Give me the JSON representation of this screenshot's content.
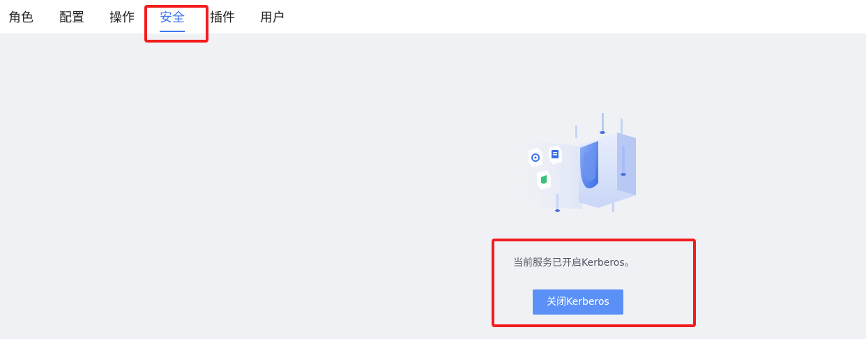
{
  "tabs": {
    "roles": "角色",
    "config": "配置",
    "operations": "操作",
    "security": "安全",
    "plugins": "插件",
    "users": "用户"
  },
  "active_tab": "security",
  "security": {
    "status_text": "当前服务已开启Kerberos。",
    "disable_button": "关闭Kerberos"
  },
  "colors": {
    "accent": "#3f76f0",
    "button": "#5b91f7",
    "annotation": "#f21c1c",
    "background": "#f0f1f5"
  },
  "icons": [
    "shield-illustration",
    "gear-icon",
    "document-icon",
    "shield-check-icon"
  ]
}
